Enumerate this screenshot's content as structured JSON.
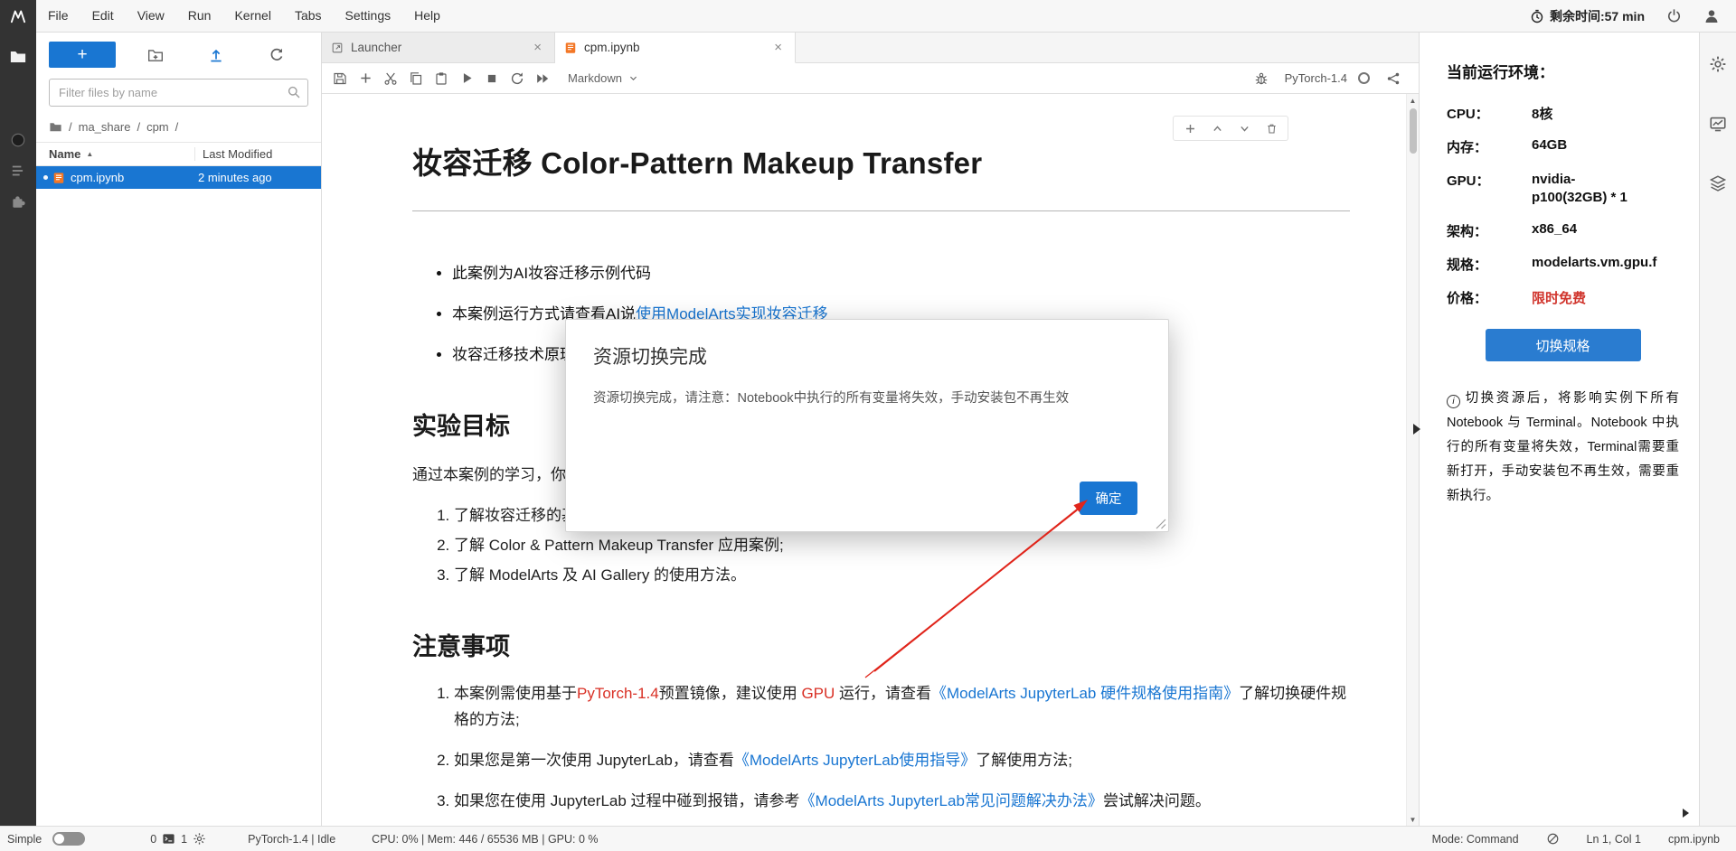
{
  "colors": {
    "accent": "#1976d2",
    "selection_blue": "#1976d2",
    "switch_button_blue": "#2a7cd0",
    "link_blue": "#1976d2",
    "warning_red": "#d93025",
    "price_red": "#d0342c",
    "annotation_arrow_red": "#e0251b",
    "notebook_icon_orange": "#f37726",
    "dark_sidebar": "#333333"
  },
  "icons": {
    "close": "×",
    "sort_asc": "▲",
    "scroll_up": "▲",
    "scroll_down": "▼",
    "info": "i"
  },
  "menubar": {
    "items": [
      "File",
      "Edit",
      "View",
      "Run",
      "Kernel",
      "Tabs",
      "Settings",
      "Help"
    ],
    "remaining_time": "剩余时间:57 min"
  },
  "filebrowser": {
    "new_button": "+",
    "filter_placeholder": "Filter files by name",
    "sep": "/",
    "breadcrumb": [
      "ma_share",
      "cpm"
    ],
    "col_name": "Name",
    "col_modified": "Last Modified",
    "file": {
      "name": "cpm.ipynb",
      "modified": "2 minutes ago"
    }
  },
  "tabs": {
    "launcher": "Launcher",
    "notebook": "cpm.ipynb"
  },
  "nbtoolbar": {
    "celltype": "Markdown",
    "kernel": "PyTorch-1.4"
  },
  "notebook": {
    "title": "妆容迁移 Color-Pattern Makeup Transfer",
    "bullet1": "此案例为AI妆容迁移示例代码",
    "bullet2_pre": "本案例运行方式请查看AI说",
    "bullet2_link": "使用ModelArts实现妆容迁移",
    "bullet3": "妆容迁移技术原理",
    "h_goal": "实验目标",
    "goal_intro": "通过本案例的学习，你",
    "goal1": "了解妆容迁移的基",
    "goal2": "了解 Color & Pattern Makeup Transfer 应用案例;",
    "goal3": "了解 ModelArts 及 AI Gallery 的使用方法。",
    "h_notes": "注意事项",
    "note1_t1": "本案例需使用基于",
    "note1_red1": "PyTorch-1.4",
    "note1_t2": "预置镜像，建议使用 ",
    "note1_red2": "GPU",
    "note1_t3": " 运行，请查看",
    "note1_link": "《ModelArts JupyterLab 硬件规格使用指南》",
    "note1_t4": "了解切换硬件规格的方法;",
    "note2_t1": "如果您是第一次使用 JupyterLab，请查看",
    "note2_link": "《ModelArts JupyterLab使用指导》",
    "note2_t2": "了解使用方法;",
    "note3_t1": "如果您在使用 JupyterLab 过程中碰到报错，请参考",
    "note3_link": "《ModelArts JupyterLab常见问题解决办法》",
    "note3_t2": "尝试解决问题。"
  },
  "modal": {
    "title": "资源切换完成",
    "body": "资源切换完成，请注意：Notebook中执行的所有变量将失效，手动安装包不再生效",
    "ok": "确定"
  },
  "env_panel": {
    "title": "当前运行环境：",
    "rows": [
      {
        "label": "CPU：",
        "value": "8核"
      },
      {
        "label": "内存：",
        "value": "64GB"
      },
      {
        "label": "GPU：",
        "value": "nvidia-p100(32GB) * 1"
      },
      {
        "label": "架构：",
        "value": "x86_64"
      },
      {
        "label": "规格：",
        "value": "modelarts.vm.gpu.f"
      },
      {
        "label": "价格：",
        "value": "限时免费"
      }
    ],
    "switch_button": "切换规格",
    "note": "切换资源后，将影响实例下所有Notebook 与 Terminal。Notebook 中执行的所有变量将失效，Terminal需要重新打开，手动安装包不再生效，需要重新执行。"
  },
  "statusbar": {
    "simple": "Simple",
    "terminals": "0",
    "kernels": "1",
    "kernel_status": "PyTorch-1.4 | Idle",
    "resources": "CPU: 0% | Mem: 446 / 65536 MB | GPU: 0 %",
    "mode": "Mode: Command",
    "cursor": "Ln 1, Col 1",
    "filename": "cpm.ipynb"
  }
}
